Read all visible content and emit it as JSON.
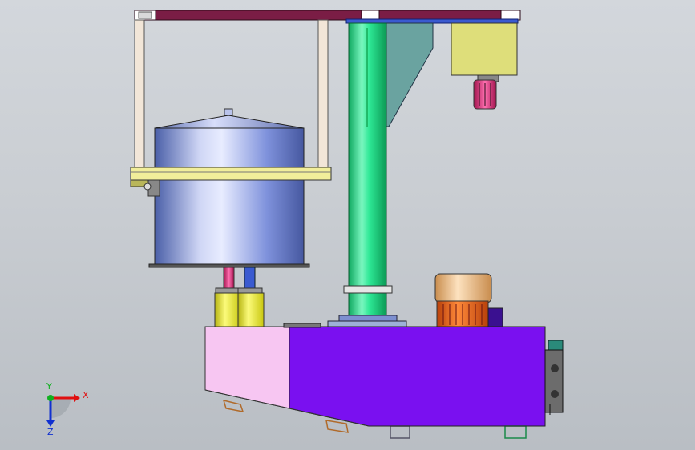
{
  "triad": {
    "x_label": "X",
    "y_label": "Y",
    "z_label": "Z",
    "x_color": "#e01010",
    "y_color": "#10b020",
    "z_color": "#1030d0"
  },
  "colors": {
    "top_beam": "#7a1d45",
    "column": "#22e08a",
    "hanger": "#f2e6d8",
    "platform": "#f1ee9a",
    "tank_body": "#8e9fe0",
    "piston": "#f4f23a",
    "base_left": "#f7c6f2",
    "base_right": "#7a10f0",
    "motor_cap": "#f3c48a",
    "motor_body": "#ef6b1b",
    "gearbox": "#dede7a",
    "brace": "#6aa3a0"
  }
}
